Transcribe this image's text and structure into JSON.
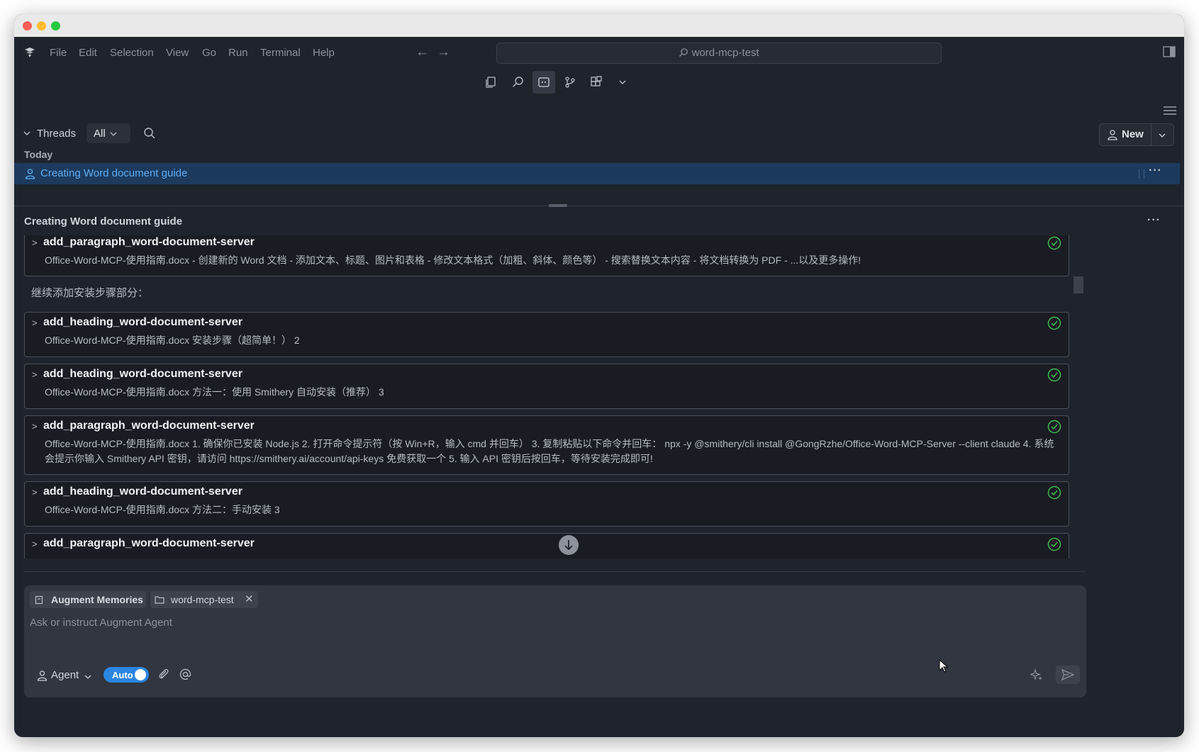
{
  "menubar": {
    "items": [
      "File",
      "Edit",
      "Selection",
      "View",
      "Go",
      "Run",
      "Terminal",
      "Help"
    ],
    "search_text": "word-mcp-test"
  },
  "toolbar": {
    "icons": [
      "copy-icon",
      "search-icon",
      "augment-icon",
      "source-control-icon",
      "extensions-icon",
      "chevron-down-icon"
    ],
    "active": "augment-icon"
  },
  "threads": {
    "title": "Threads",
    "filter": "All",
    "new_label": "New",
    "group": "Today",
    "items": [
      {
        "label": "Creating Word document guide"
      }
    ]
  },
  "conversation": {
    "title": "Creating Word document guide",
    "text_between": "继续添加安装步骤部分：",
    "tool_calls": [
      {
        "name": "add_paragraph_word-document-server",
        "desc": "Office-Word-MCP-使用指南.docx - 创建新的 Word 文档 - 添加文本、标题、图片和表格 - 修改文本格式（加粗、斜体、颜色等） - 搜索替换文本内容 - 将文档转换为 PDF - ...以及更多操作!"
      },
      {
        "name": "add_heading_word-document-server",
        "desc": "Office-Word-MCP-使用指南.docx 安装步骤（超简单！） 2"
      },
      {
        "name": "add_heading_word-document-server",
        "desc": "Office-Word-MCP-使用指南.docx 方法一：使用 Smithery 自动安装（推荐） 3"
      },
      {
        "name": "add_paragraph_word-document-server",
        "desc": "Office-Word-MCP-使用指南.docx 1. 确保你已安装 Node.js 2. 打开命令提示符（按 Win+R，输入 cmd 并回车） 3. 复制粘贴以下命令并回车： npx -y @smithery/cli install @GongRzhe/Office-Word-MCP-Server --client claude 4. 系统会提示你输入 Smithery API 密钥，请访问 https://smithery.ai/account/api-keys 免费获取一个 5. 输入 API 密钥后按回车，等待安装完成即可!"
      },
      {
        "name": "add_heading_word-document-server",
        "desc": "Office-Word-MCP-使用指南.docx 方法二：手动安装 3"
      },
      {
        "name": "add_paragraph_word-document-server",
        "desc": ""
      }
    ]
  },
  "input": {
    "chips": [
      "Augment Memories",
      "word-mcp-test"
    ],
    "placeholder": "Ask or instruct Augment Agent",
    "mode": "Agent",
    "auto_label": "Auto",
    "auto_on": true
  },
  "colors": {
    "background": "#1f232c",
    "accent": "#2b86e2",
    "selected_row": "#1c3a5e",
    "success": "#3fb950"
  }
}
